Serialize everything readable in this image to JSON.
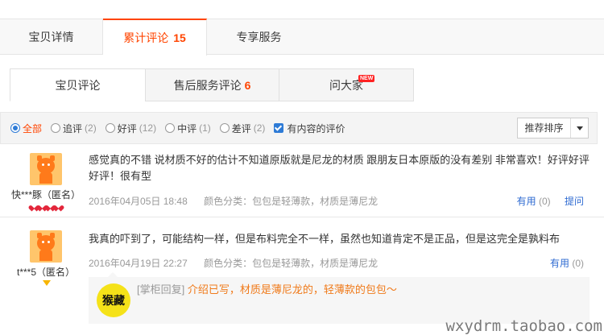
{
  "main_tabs": [
    {
      "label": "宝贝详情"
    },
    {
      "label": "累计评论",
      "count": "15"
    },
    {
      "label": "专享服务"
    }
  ],
  "sub_tabs": [
    {
      "label": "宝贝评论"
    },
    {
      "label": "售后服务评论",
      "count": "6"
    },
    {
      "label": "问大家",
      "badge": "NEW"
    }
  ],
  "filters": {
    "options": [
      {
        "label": "全部",
        "count": "",
        "selected": true
      },
      {
        "label": "追评",
        "count": "(2)"
      },
      {
        "label": "好评",
        "count": "(12)"
      },
      {
        "label": "中评",
        "count": "(1)"
      },
      {
        "label": "差评",
        "count": "(2)"
      }
    ],
    "checkbox_label": "有内容的评价",
    "sort_label": "推荐排序"
  },
  "reviews": [
    {
      "user": "快***豚（匿名）",
      "rank_icon": "heart-icon",
      "text": "感觉真的不错 说材质不好的估计不知道原版就是尼龙的材质 跟朋友日本原版的没有差别 非常喜欢！好评好评好评！很有型",
      "date": "2016年04月05日 18:48",
      "sku": "颜色分类：包包是轻薄款，材质是薄尼龙",
      "useful_label": "有用",
      "useful_count": "(0)",
      "ask_label": "提问"
    },
    {
      "user": "t***5（匿名）",
      "rank_icon": "diamond-icon",
      "text": "我真的吓到了，可能结构一样，但是布料完全不一样，虽然也知道肯定不是正品，但是这完全是孰料布",
      "date": "2016年04月19日 22:27",
      "sku": "颜色分类：包包是轻薄款，材质是薄尼龙",
      "useful_label": "有用",
      "useful_count": "(0)",
      "reply_tag": "[掌柜回复]",
      "reply_text": "介绍已写，材质是薄尼龙的，轻薄款的包包～",
      "shop_logo_text": "猴藏"
    }
  ],
  "watermark": "wxydrm.taobao.com",
  "colors": {
    "accent": "#ff4400",
    "link": "#2e6ad1",
    "reply": "#f07a1a"
  }
}
